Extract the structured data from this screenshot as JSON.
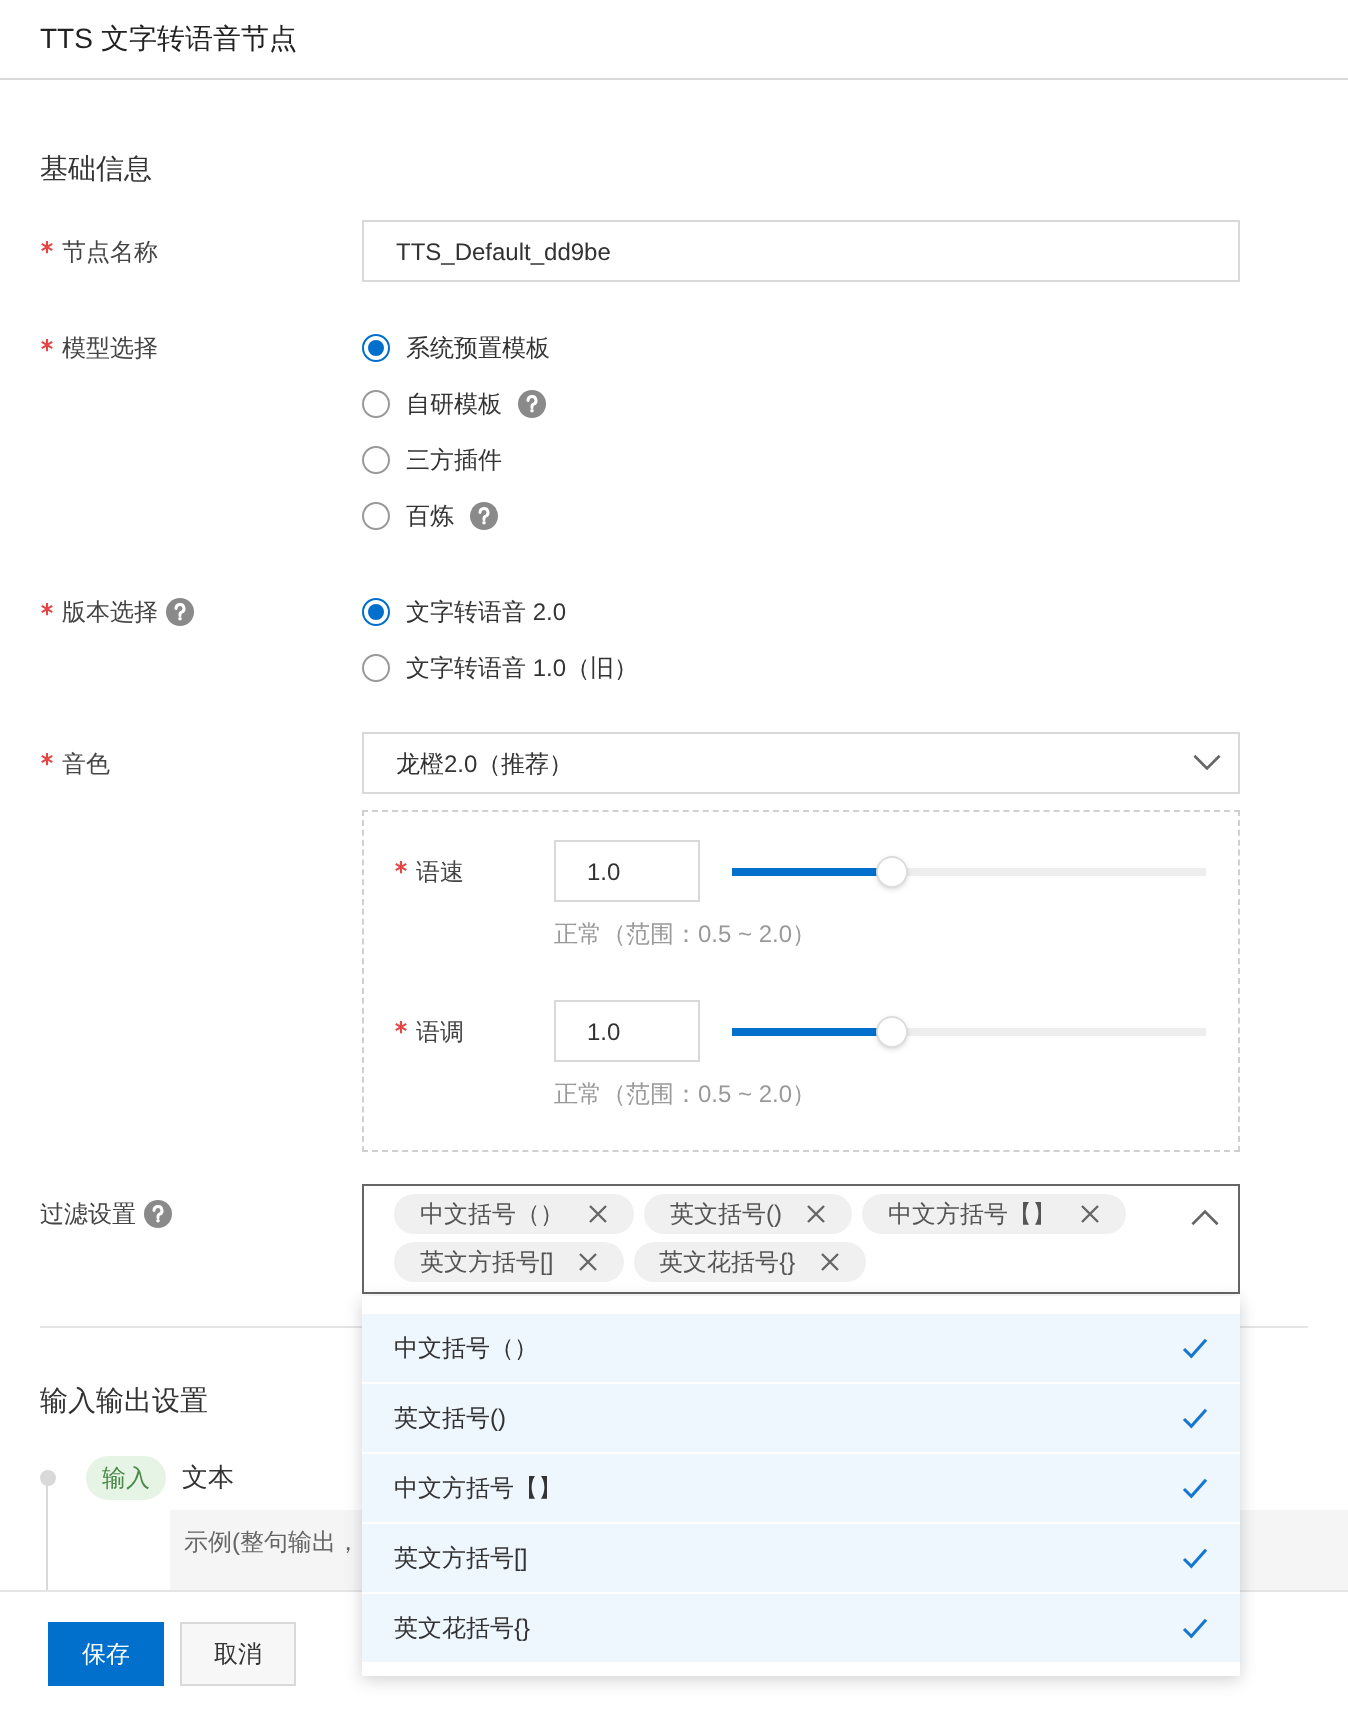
{
  "header": {
    "title": "TTS 文字转语音节点"
  },
  "basic": {
    "title": "基础信息",
    "fields": [
      {
        "kind": "text",
        "label": "节点名称",
        "required": true,
        "value": "TTS_Default_dd9be"
      },
      {
        "kind": "radio",
        "label": "模型选择",
        "required": true,
        "options": [
          {
            "label": "系统预置模板",
            "selected": true,
            "help": false
          },
          {
            "label": "自研模板",
            "selected": false,
            "help": true
          },
          {
            "label": "三方插件",
            "selected": false,
            "help": false
          },
          {
            "label": "百炼",
            "selected": false,
            "help": true
          }
        ]
      },
      {
        "kind": "radio",
        "label": "版本选择",
        "required": true,
        "help": true,
        "options": [
          {
            "label": "文字转语音 2.0",
            "selected": true,
            "help": false
          },
          {
            "label": "文字转语音 1.0（旧）",
            "selected": false,
            "help": false
          }
        ]
      },
      {
        "kind": "select",
        "label": "音色",
        "required": true,
        "value": "龙橙2.0（推荐）",
        "params": [
          {
            "label": "语速",
            "required": true,
            "value": "1.0",
            "level": 0.34,
            "hint": "正常（范围：0.5 ~ 2.0）"
          },
          {
            "label": "语调",
            "required": true,
            "value": "1.0",
            "level": 0.34,
            "hint": "正常（范围：0.5 ~ 2.0）"
          }
        ]
      },
      {
        "kind": "tags",
        "label": "过滤设置",
        "help": true,
        "expanded": true,
        "tags": [
          "中文括号（）",
          "英文括号()",
          "中文方括号【】",
          "英文方括号[]",
          "英文花括号{}"
        ],
        "options": [
          {
            "label": "中文括号（）",
            "selected": true
          },
          {
            "label": "英文括号()",
            "selected": true
          },
          {
            "label": "中文方括号【】",
            "selected": true
          },
          {
            "label": "英文方括号[]",
            "selected": true
          },
          {
            "label": "英文花括号{}",
            "selected": true
          }
        ]
      }
    ]
  },
  "io": {
    "title": "输入输出设置",
    "input": {
      "badge": "输入",
      "label": "文本",
      "sample": "示例(整句输出，"
    }
  },
  "footer": {
    "buttons": [
      {
        "label": "保存",
        "kind": "primary"
      },
      {
        "label": "取消",
        "kind": "default"
      }
    ]
  }
}
